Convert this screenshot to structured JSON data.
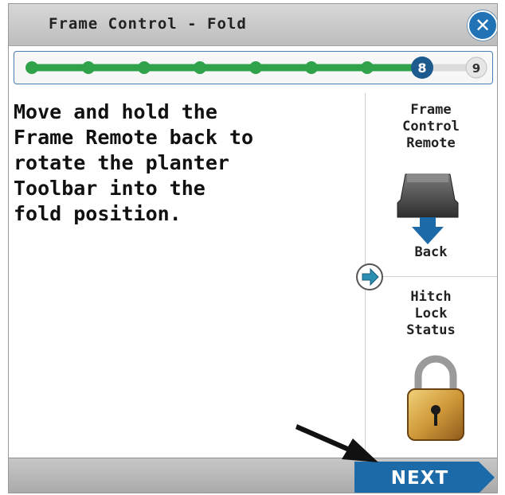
{
  "title": "Frame Control - Fold",
  "close_icon": "close-x-icon",
  "progress": {
    "current_step": 8,
    "next_step": 9,
    "current_label": "8",
    "next_label": "9",
    "total_steps": 9
  },
  "instruction": "Move and hold the\nFrame Remote back to\nrotate the planter\nToolbar into the\nfold position.",
  "remote_panel": {
    "label": "Frame\nControl\nRemote",
    "action": "Back",
    "icon": "remote-lever-icon"
  },
  "arrow_icon": "right-arrow-icon",
  "hitch_panel": {
    "label": "Hitch\nLock\nStatus",
    "icon": "padlock-locked-icon"
  },
  "footer": {
    "next_label": "NEXT"
  },
  "colors": {
    "accent": "#1d6aa8",
    "progress_done": "#2fa24a",
    "progress_current": "#1d5a8e"
  }
}
